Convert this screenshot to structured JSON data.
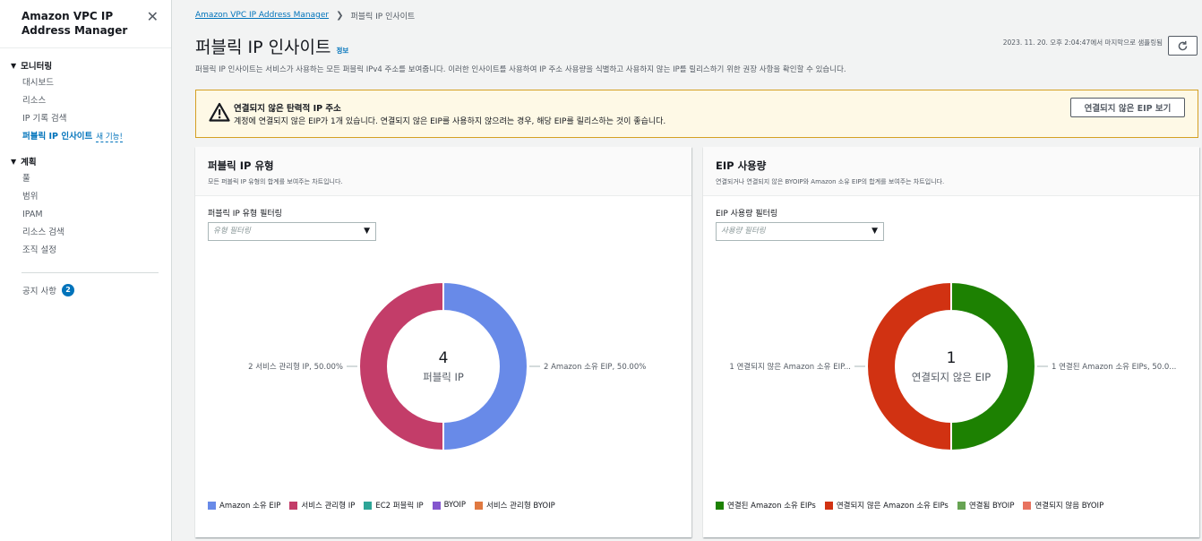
{
  "sidebar": {
    "title": "Amazon VPC IP Address Manager",
    "sections": [
      {
        "label": "모니터링",
        "items": [
          "대시보드",
          "리소스",
          "IP 기록 검색",
          "퍼블릭 IP 인사이트"
        ]
      },
      {
        "label": "계획",
        "items": [
          "풀",
          "범위",
          "IPAM",
          "리소스 검색",
          "조직 설정"
        ]
      }
    ],
    "new_feature": "새 기능!",
    "notices_label": "공지 사항",
    "notices_count": "2"
  },
  "breadcrumb": {
    "root": "Amazon VPC IP Address Manager",
    "current": "퍼블릭 IP 인사이트"
  },
  "header": {
    "title": "퍼블릭 IP 인사이트",
    "info": "정보",
    "last_fetched": "2023. 11. 20. 오후 2:04:47에서 마지막으로 샘플링됨",
    "description": "퍼블릭 IP 인사이트는 서비스가 사용하는 모든 퍼블릭 IPv4 주소를 보여줍니다. 이러한 인사이트를 사용하여 IP 주소 사용량을 식별하고 사용하지 않는 IP를 릴리스하기 위한 권장 사항을 확인할 수 있습니다."
  },
  "alert": {
    "title": "연결되지 않은 탄력적 IP 주소",
    "text": "계정에 연결되지 않은 EIP가 1개 있습니다. 연결되지 않은 EIP를 사용하지 않으려는 경우, 해당 EIP를 릴리스하는 것이 좋습니다.",
    "button": "연결되지 않은 EIP 보기"
  },
  "colors": {
    "amazon_eip": "#688ae8",
    "service_managed": "#c33d69",
    "ec2": "#2ea597",
    "byoip": "#8456ce",
    "service_byoip": "#e07941",
    "assoc_amazon": "#1d8102",
    "unassoc_amazon": "#d13212",
    "assoc_byoip": "#67a353",
    "unassoc_byoip": "#e8725f"
  },
  "panel_left": {
    "title": "퍼블릭 IP 유형",
    "subtitle": "모든 퍼블릭 IP 유형의 합계를 보여주는 차트입니다.",
    "filter_label": "퍼블릭 IP 유형 필터링",
    "filter_placeholder": "유형 필터링",
    "center_value": "4",
    "center_label": "퍼블릭 IP",
    "label_left": "2 서비스 관리형 IP, 50.00%",
    "label_right": "2 Amazon 소유 EIP, 50.00%",
    "legend": [
      "Amazon 소유 EIP",
      "서비스 관리형 IP",
      "EC2 퍼블릭 IP",
      "BYOIP",
      "서비스 관리형 BYOIP"
    ]
  },
  "panel_right": {
    "title": "EIP 사용량",
    "subtitle": "연결되거나 연결되지 않은 BYOIP와 Amazon 소유 EIP의 합계를 보여주는 차트입니다.",
    "filter_label": "EIP 사용량 필터링",
    "filter_placeholder": "사용량 필터링",
    "center_value": "1",
    "center_label": "연결되지 않은 EIP",
    "label_left": "1 연결되지 않은 Amazon 소유 EIP...",
    "label_right": "1 연결된 Amazon 소유 EIPs, 50.0...",
    "legend": [
      "연결된 Amazon 소유 EIPs",
      "연결되지 않은 Amazon 소유 EIPs",
      "연결됨 BYOIP",
      "연결되지 않음 BYOIP"
    ]
  },
  "chart_data": [
    {
      "type": "pie",
      "title": "퍼블릭 IP 유형",
      "categories": [
        "Amazon 소유 EIP",
        "서비스 관리형 IP",
        "EC2 퍼블릭 IP",
        "BYOIP",
        "서비스 관리형 BYOIP"
      ],
      "values": [
        2,
        2,
        0,
        0,
        0
      ],
      "colors": [
        "#688ae8",
        "#c33d69",
        "#2ea597",
        "#8456ce",
        "#e07941"
      ],
      "legend": "bottom"
    },
    {
      "type": "pie",
      "title": "EIP 사용량",
      "categories": [
        "연결된 Amazon 소유 EIPs",
        "연결되지 않은 Amazon 소유 EIPs",
        "연결됨 BYOIP",
        "연결되지 않음 BYOIP"
      ],
      "values": [
        1,
        1,
        0,
        0
      ],
      "colors": [
        "#1d8102",
        "#d13212",
        "#67a353",
        "#e8725f"
      ],
      "legend": "bottom"
    }
  ]
}
